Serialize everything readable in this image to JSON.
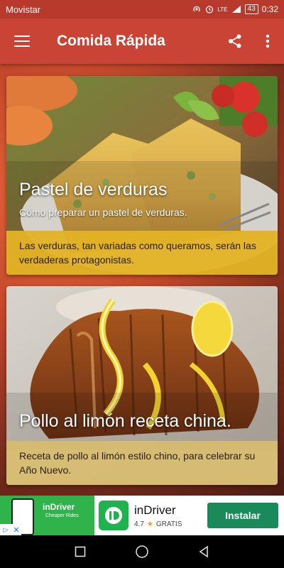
{
  "status_bar": {
    "carrier": "Movistar",
    "network": "LTE",
    "battery": "43",
    "time": "0:32"
  },
  "toolbar": {
    "title": "Comida Rápida",
    "icons": [
      "menu-icon",
      "share-icon",
      "more-vert-icon"
    ]
  },
  "cards": [
    {
      "title": "Pastel de verduras",
      "subtitle": "Cómo preparar un pastel de verduras.",
      "description": "Las verduras, tan variadas como queramos, serán las verdaderas protagonistas."
    },
    {
      "title": "Pollo al limón receta china.",
      "subtitle": "",
      "description": "Receta de pollo al limón estilo chino, para celebrar su Año Nuevo."
    }
  ],
  "ad": {
    "thumb_title": "inDriver",
    "thumb_tagline": "Cheaper Rides",
    "app_name": "inDriver",
    "rating": "4.7",
    "price": "GRATIS",
    "cta": "Instalar",
    "colors": {
      "brand": "#1fb34f",
      "button": "#1a8a5a"
    }
  },
  "colors": {
    "status_bar": "#b83a2c",
    "toolbar": "#c94434",
    "card1_desc_bg": "#e2b224",
    "card2_desc_bg": "#d8bc6e"
  }
}
